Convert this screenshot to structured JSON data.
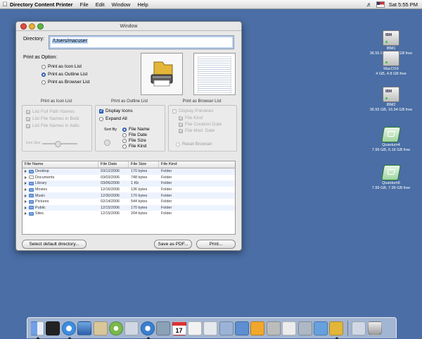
{
  "menubar": {
    "app_name": "Directory Content Printer",
    "items": [
      "File",
      "Edit",
      "Window",
      "Help"
    ],
    "clock": "Sat 5:55 PM"
  },
  "desktop": {
    "volumes": [
      {
        "name": "IBM1",
        "info": "36.55 GB, 10.34 GB free"
      },
      {
        "name": "MacOS9",
        "info": "4 GB, 4.8 GB free"
      },
      {
        "name": "IBM2",
        "info": "36.55 GB, 16.94 GB free"
      },
      {
        "name": "Quantum4",
        "info": "7.99 GB, 6.16 GB free"
      },
      {
        "name": "Quantum6",
        "info": "7.99 GB, 7.99 GB free"
      }
    ]
  },
  "window": {
    "title": "Window",
    "directory_label": "Directory:",
    "directory_value": "/Users/macuser",
    "print_as_label": "Print as Option:",
    "print_options": [
      {
        "label": "Print as Icon List",
        "selected": false
      },
      {
        "label": "Print as Outline List",
        "selected": true
      },
      {
        "label": "Print as Browser List",
        "selected": false
      }
    ],
    "icon_list": {
      "title": "Print as Icon List",
      "options": [
        "List Full Path Names",
        "List File Names in Bold",
        "List File Names in Italic"
      ],
      "slider_label": "Icon Size"
    },
    "outline_list": {
      "title": "Print as Outline List",
      "display_icons": "Display Icons",
      "expand_all": "Expand All",
      "sort_by_label": "Sort By",
      "sort_options": [
        {
          "label": "File Name",
          "selected": true
        },
        {
          "label": "File Date",
          "selected": false
        },
        {
          "label": "File Size",
          "selected": false
        },
        {
          "label": "File Kind",
          "selected": false
        }
      ]
    },
    "browser_list": {
      "title": "Print as Browser List",
      "display_previews": "Display Previews",
      "options": [
        "File Kind",
        "File Creation Date",
        "File Mod. Date"
      ],
      "reset": "Reset Browser"
    },
    "columns": [
      "File Name",
      "File Date",
      "File Size",
      "File Kind"
    ],
    "rows": [
      {
        "name": "Desktop",
        "date": "03/12/2006",
        "size": "170 bytes",
        "kind": "Folder"
      },
      {
        "name": "Documents",
        "date": "03/03/2006",
        "size": "748 bytes",
        "kind": "Folder"
      },
      {
        "name": "Library",
        "date": "03/06/2006",
        "size": "1 Kb",
        "kind": "Folder"
      },
      {
        "name": "Movies",
        "date": "12/16/2006",
        "size": "136 bytes",
        "kind": "Folder"
      },
      {
        "name": "Music",
        "date": "12/30/2006",
        "size": "170 bytes",
        "kind": "Folder"
      },
      {
        "name": "Pictures",
        "date": "02/14/2006",
        "size": "544 bytes",
        "kind": "Folder"
      },
      {
        "name": "Public",
        "date": "12/15/2006",
        "size": "170 bytes",
        "kind": "Folder"
      },
      {
        "name": "Sites",
        "date": "12/15/2006",
        "size": "204 bytes",
        "kind": "Folder"
      }
    ],
    "buttons": {
      "select_default": "Select default directory...",
      "save_pdf": "Save as PDF...",
      "print": "Print..."
    }
  },
  "dock": {
    "calendar_day": "17"
  },
  "colors": {
    "desktop": "#4a6ea5",
    "selection": "#b5d1f5",
    "accent": "#2e63c4"
  }
}
